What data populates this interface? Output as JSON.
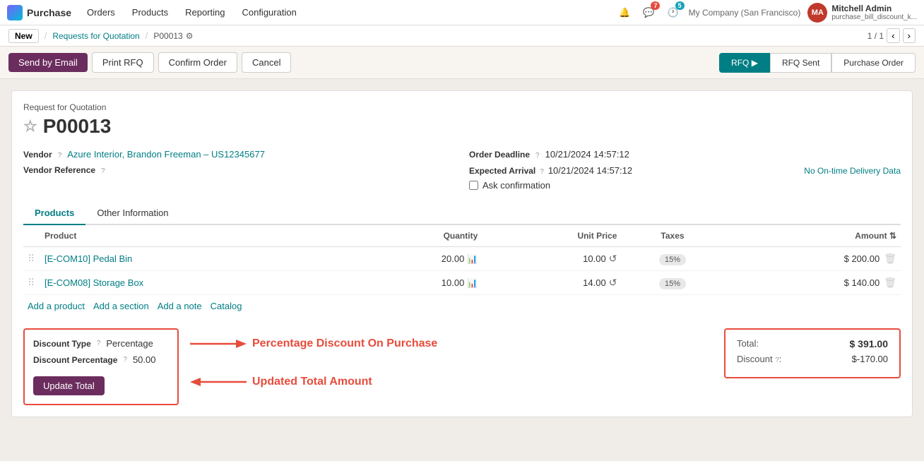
{
  "navbar": {
    "brand": "Purchase",
    "nav_items": [
      "Orders",
      "Products",
      "Reporting",
      "Configuration"
    ],
    "notifications_count": "7",
    "alerts_count": "5",
    "company": "My Company (San Francisco)",
    "user_name": "Mitchell Admin",
    "user_sub": "purchase_bill_discount_k...",
    "user_initials": "MA"
  },
  "breadcrumb": {
    "new_label": "New",
    "parent": "Requests for Quotation",
    "current": "P00013",
    "pager": "1 / 1"
  },
  "actions": {
    "send_email": "Send by Email",
    "print_rfq": "Print RFQ",
    "confirm_order": "Confirm Order",
    "cancel": "Cancel"
  },
  "status_steps": [
    {
      "label": "RFQ",
      "active": true
    },
    {
      "label": "RFQ Sent",
      "active": false
    },
    {
      "label": "Purchase Order",
      "active": false
    }
  ],
  "form": {
    "title_small": "Request for Quotation",
    "title_big": "P00013",
    "vendor_label": "Vendor",
    "vendor_value": "Azure Interior, Brandon Freeman – US12345677",
    "vendor_ref_label": "Vendor Reference",
    "order_deadline_label": "Order Deadline",
    "order_deadline_value": "10/21/2024 14:57:12",
    "expected_arrival_label": "Expected Arrival",
    "expected_arrival_value": "10/21/2024 14:57:12",
    "no_delivery": "No On-time Delivery Data",
    "ask_confirmation": "Ask confirmation"
  },
  "tabs": [
    {
      "label": "Products",
      "active": true
    },
    {
      "label": "Other Information",
      "active": false
    }
  ],
  "table": {
    "headers": [
      "Product",
      "Quantity",
      "Unit Price",
      "Taxes",
      "Amount"
    ],
    "rows": [
      {
        "product": "[E-COM10] Pedal Bin",
        "quantity": "20.00",
        "unit_price": "10.00",
        "taxes": "15%",
        "amount": "$ 200.00"
      },
      {
        "product": "[E-COM08] Storage Box",
        "quantity": "10.00",
        "unit_price": "14.00",
        "taxes": "15%",
        "amount": "$ 140.00"
      }
    ]
  },
  "add_links": [
    "Add a product",
    "Add a section",
    "Add a note",
    "Catalog"
  ],
  "discount": {
    "type_label": "Discount Type",
    "type_help": "?",
    "type_value": "Percentage",
    "pct_label": "Discount Percentage",
    "pct_help": "?",
    "pct_value": "50.00",
    "update_btn": "Update Total"
  },
  "annotations": {
    "text1": "Percentage Discount On Purchase",
    "text2": "Updated Total Amount"
  },
  "totals": {
    "total_label": "Total:",
    "total_value": "$ 391.00",
    "discount_label": "Discount",
    "discount_help": "?",
    "discount_value": "$-170.00"
  }
}
